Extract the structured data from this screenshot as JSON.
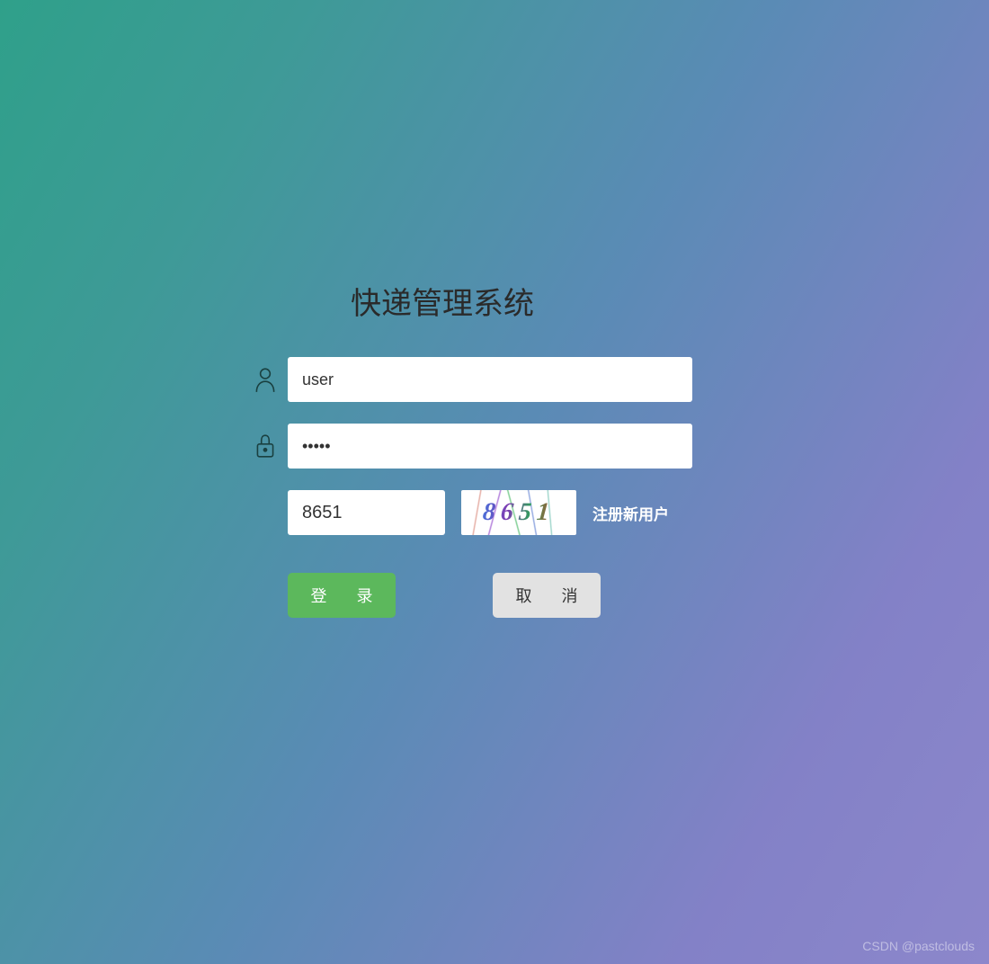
{
  "title": "快递管理系统",
  "form": {
    "username": {
      "value": "user",
      "placeholder": ""
    },
    "password": {
      "value": "•••••",
      "placeholder": ""
    },
    "captcha_input": {
      "value": "8651"
    },
    "captcha_image_text": "8651",
    "register_link": "注册新用户"
  },
  "buttons": {
    "login": "登 录",
    "cancel": "取 消"
  },
  "watermark": "CSDN @pastclouds"
}
